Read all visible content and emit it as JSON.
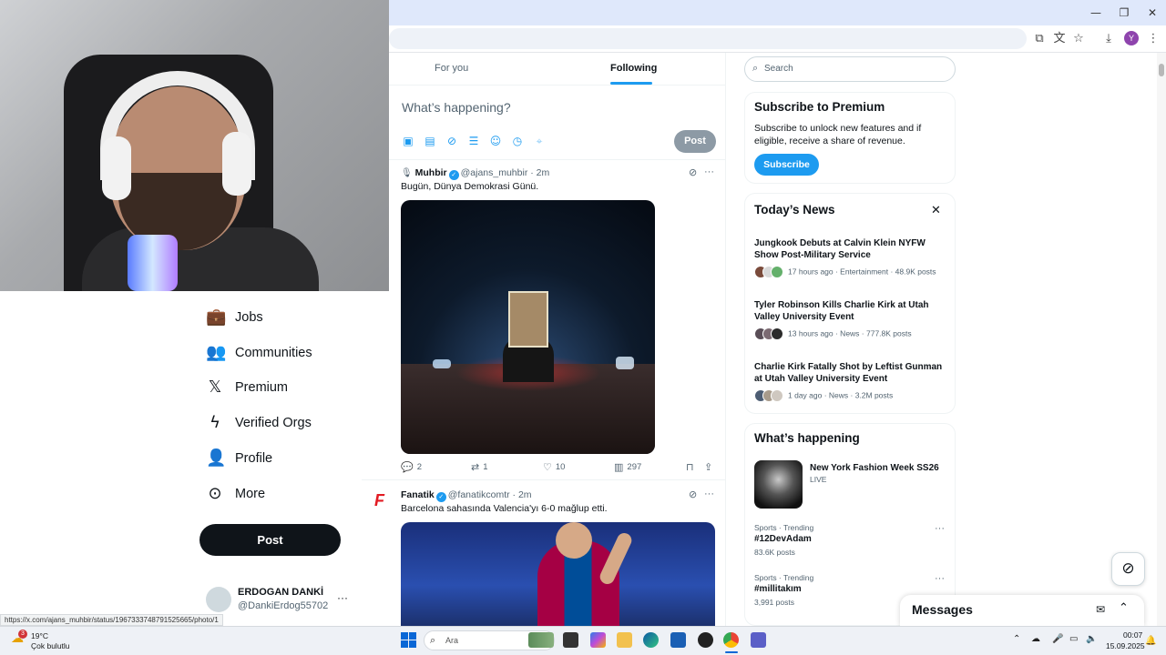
{
  "browser": {
    "window_controls": [
      "—",
      "❐",
      "✕"
    ],
    "toolbar_icons": [
      "install-icon",
      "translate-icon",
      "bookmark-star-icon",
      "download-icon",
      "profile-avatar",
      "menu-icon"
    ],
    "profile_initial": "Y"
  },
  "sidebar": {
    "items": [
      {
        "label": "Jobs",
        "icon": "briefcase-icon"
      },
      {
        "label": "Communities",
        "icon": "communities-icon"
      },
      {
        "label": "Premium",
        "icon": "x-logo-icon"
      },
      {
        "label": "Verified Orgs",
        "icon": "lightning-icon"
      },
      {
        "label": "Profile",
        "icon": "person-icon"
      },
      {
        "label": "More",
        "icon": "more-circle-icon"
      }
    ],
    "post_label": "Post",
    "account": {
      "name": "ERDOGAN DANKİ",
      "handle": "@DankiErdog55702",
      "more": "···"
    }
  },
  "timeline": {
    "tabs": [
      {
        "label": "For you",
        "active": false
      },
      {
        "label": "Following",
        "active": true
      }
    ],
    "compose": {
      "placeholder": "What’s happening?",
      "post_label": "Post"
    },
    "tweets": [
      {
        "name": "Muhbir",
        "handle": "@ajans_muhbir",
        "time": "2m",
        "text": "Bugün, Dünya Demokrasi Günü.",
        "replies": "2",
        "reposts": "1",
        "likes": "10",
        "views": "297"
      },
      {
        "name": "Fanatik",
        "handle": "@fanatikcomtr",
        "time": "2m",
        "text": "Barcelona sahasında Valencia'yı 6-0 mağlup etti."
      }
    ]
  },
  "right": {
    "search_placeholder": "Search",
    "premium": {
      "title": "Subscribe to Premium",
      "text": "Subscribe to unlock new features and if eligible, receive a share of revenue.",
      "button": "Subscribe"
    },
    "news": {
      "title": "Today’s News",
      "items": [
        {
          "title": "Jungkook Debuts at Calvin Klein NYFW Show Post-Military Service",
          "meta": "17 hours ago · Entertainment · 48.9K posts"
        },
        {
          "title": "Tyler Robinson Kills Charlie Kirk at Utah Valley University Event",
          "meta": "13 hours ago · News · 777.8K posts"
        },
        {
          "title": "Charlie Kirk Fatally Shot by Leftist Gunman at Utah Valley University Event",
          "meta": "1 day ago · News · 3.2M posts"
        }
      ]
    },
    "happening": {
      "title": "What’s happening",
      "event": {
        "title": "New York Fashion Week SS26",
        "status": "LIVE"
      },
      "trends": [
        {
          "category": "Sports · Trending",
          "name": "#12DevAdam",
          "count": "83.6K posts"
        },
        {
          "category": "Sports · Trending",
          "name": "#millitakım",
          "count": "3,991 posts"
        }
      ]
    },
    "messages_title": "Messages"
  },
  "status_url": "https://x.com/ajans_muhbir/status/1967333748791525665/photo/1",
  "taskbar": {
    "weather_temp": "19°C",
    "weather_desc": "Çok bulutlu",
    "weather_badge": "3",
    "search_text": "Ara",
    "time": "00:07",
    "date": "15.09.2025"
  },
  "colors": {
    "accent": "#1d9bf0",
    "text": "#0f1419",
    "muted": "#536471"
  }
}
